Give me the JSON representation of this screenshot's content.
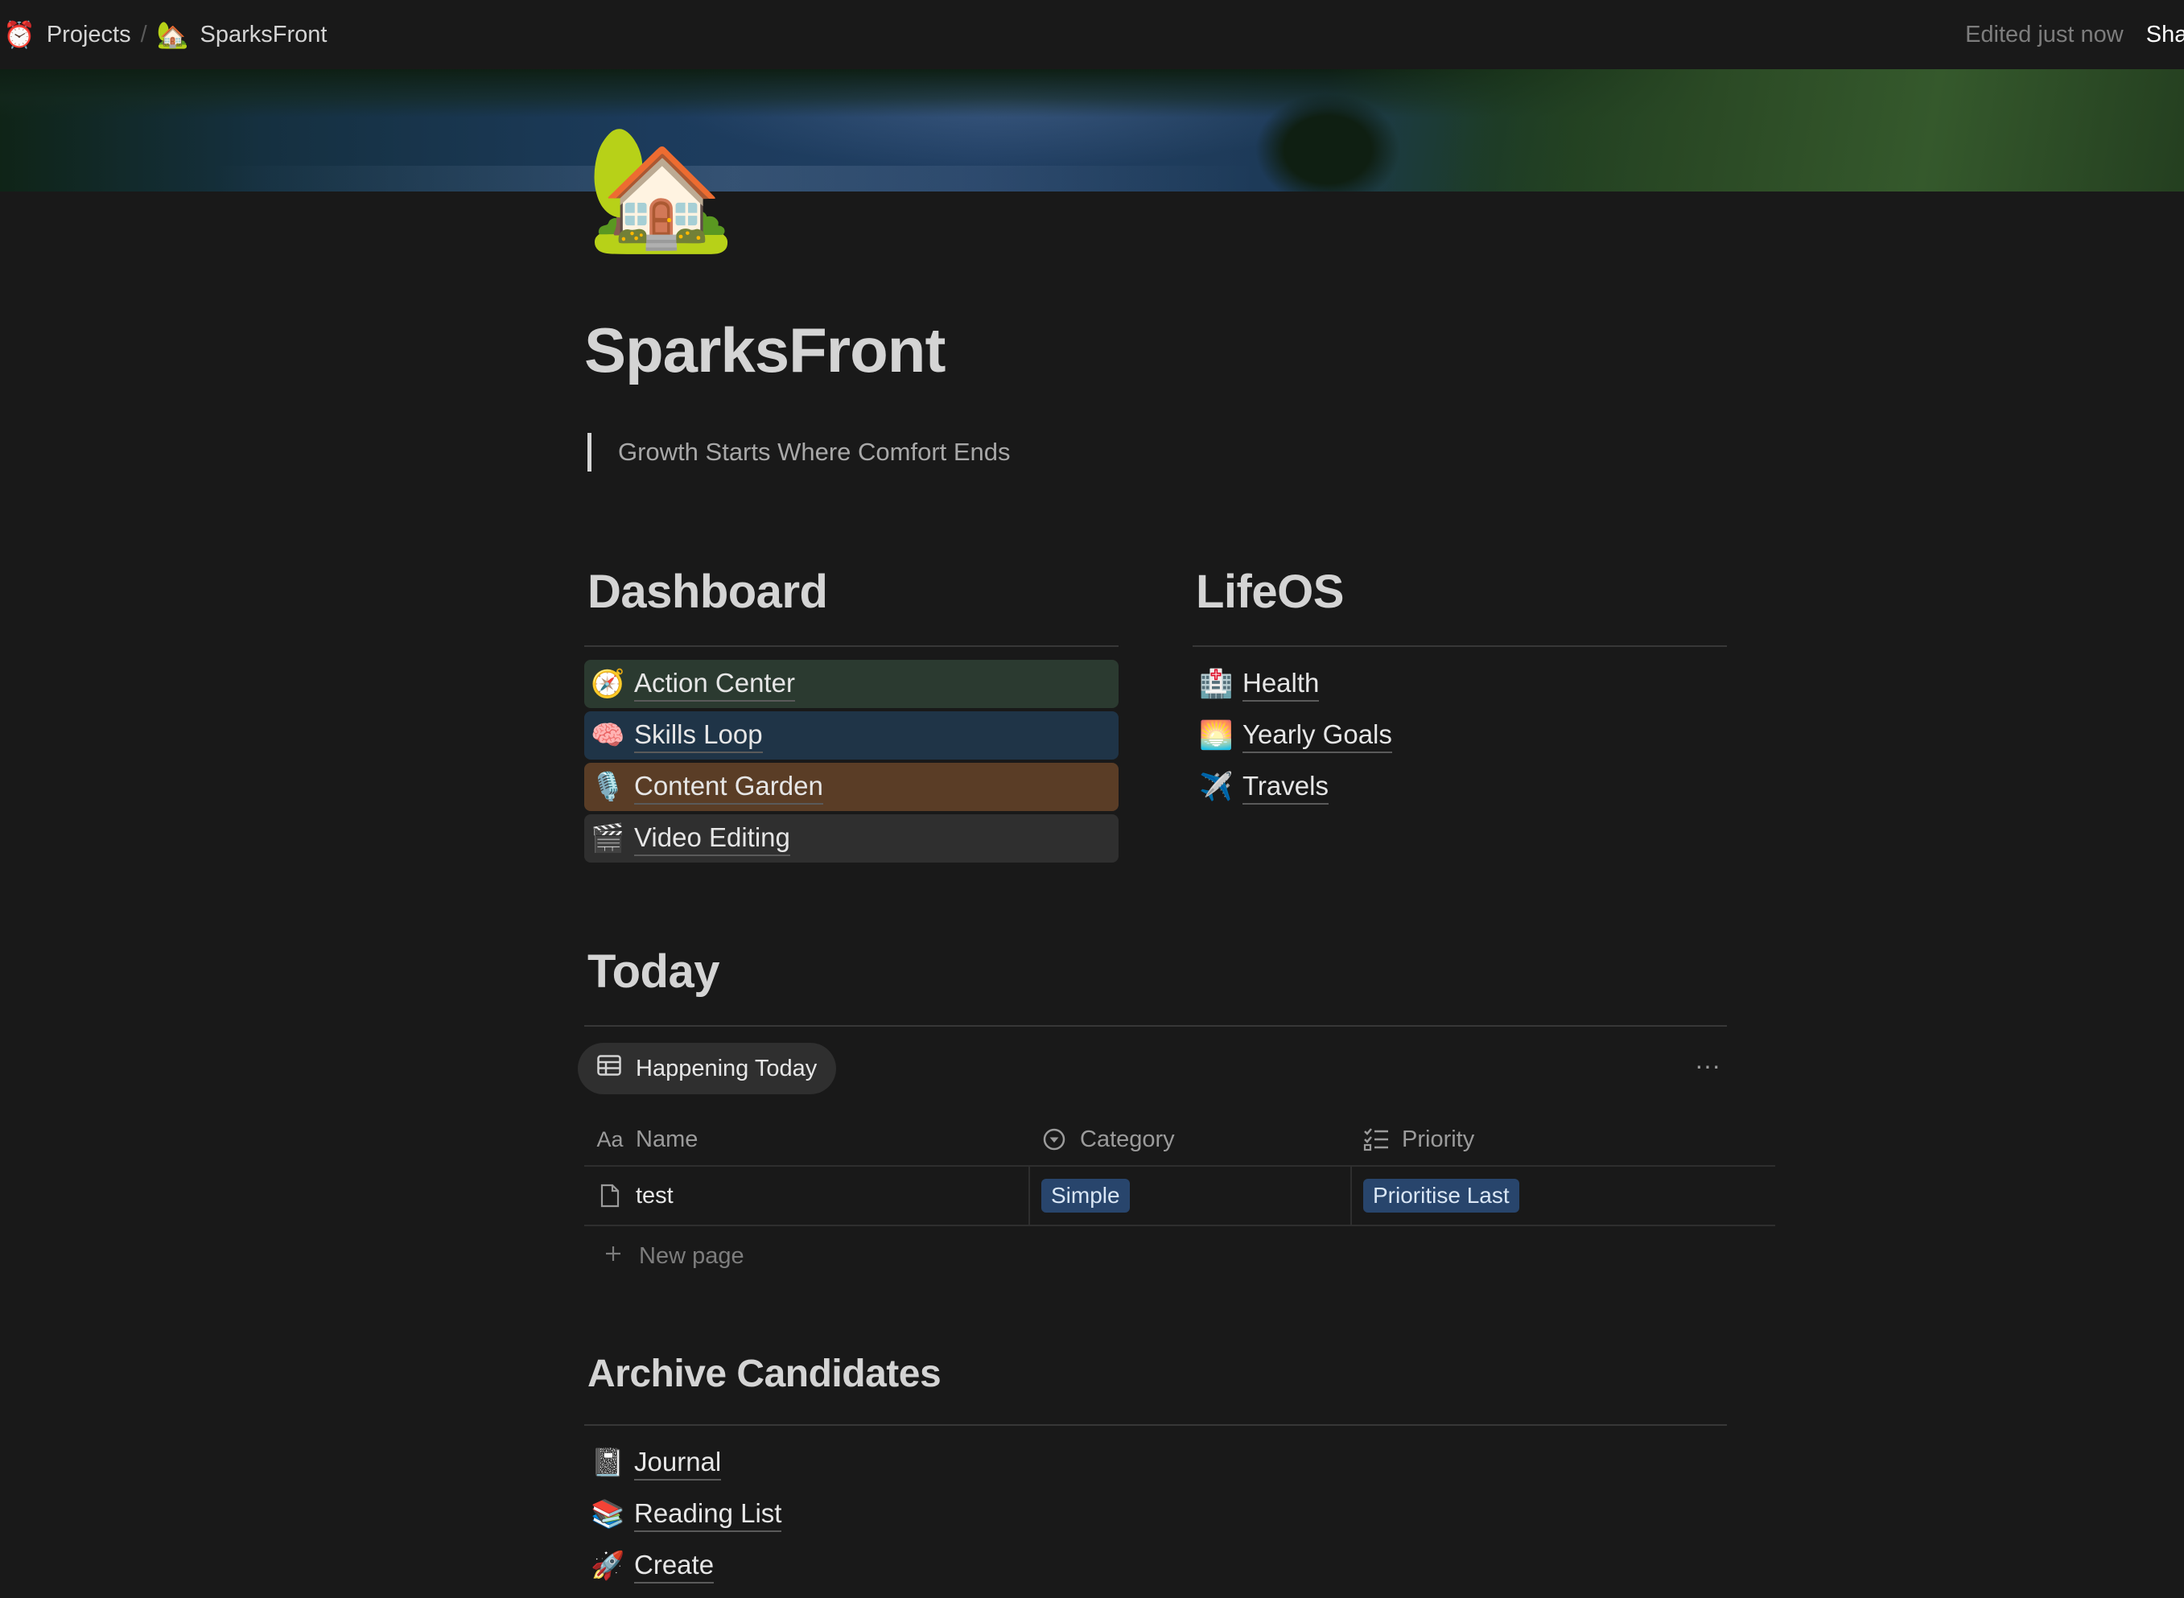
{
  "breadcrumb": [
    {
      "icon": "⏰",
      "label": "Projects"
    },
    {
      "icon": "🏡",
      "label": "SparksFront"
    }
  ],
  "topbar": {
    "edited": "Edited just now",
    "share": "Shar"
  },
  "page": {
    "icon": "🏡",
    "title": "SparksFront",
    "quote": "Growth Starts Where Comfort Ends"
  },
  "dashboard": {
    "heading": "Dashboard",
    "items": [
      {
        "icon": "🧭",
        "label": "Action Center",
        "bg": "#2b3a30"
      },
      {
        "icon": "🧠",
        "label": "Skills Loop",
        "bg": "#1f3447"
      },
      {
        "icon": "🎙️",
        "label": "Content Garden",
        "bg": "#5a3d26"
      },
      {
        "icon": "🎬",
        "label": "Video Editing",
        "bg": "#2f2f2f"
      }
    ]
  },
  "lifeos": {
    "heading": "LifeOS",
    "items": [
      {
        "icon": "🏥",
        "label": "Health"
      },
      {
        "icon": "🌅",
        "label": "Yearly Goals"
      },
      {
        "icon": "✈️",
        "label": "Travels"
      }
    ]
  },
  "today": {
    "heading": "Today",
    "view_label": "Happening Today",
    "more": "···",
    "columns": [
      {
        "icon": "Aa",
        "label": "Name"
      },
      {
        "icon": "category-icon",
        "label": "Category"
      },
      {
        "icon": "checklist-icon",
        "label": "Priority"
      }
    ],
    "rows": [
      {
        "name": "test",
        "category": "Simple",
        "priority": "Prioritise Last"
      }
    ],
    "new_page": "New page",
    "tag_color": "#28456c"
  },
  "archive": {
    "heading": "Archive Candidates",
    "items": [
      {
        "icon": "📓",
        "label": "Journal"
      },
      {
        "icon": "📚",
        "label": "Reading List"
      },
      {
        "icon": "🚀",
        "label": "Create"
      }
    ]
  }
}
